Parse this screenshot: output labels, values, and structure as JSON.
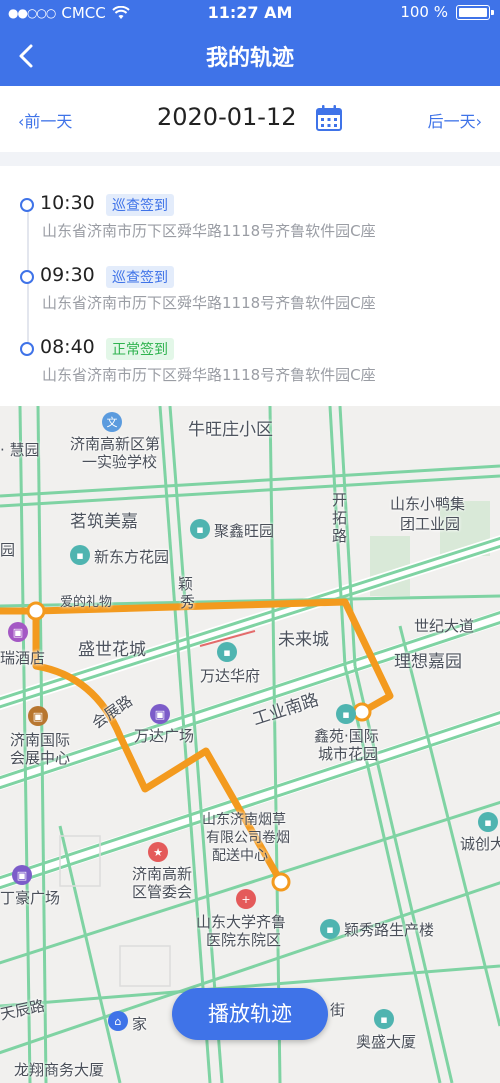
{
  "status_bar": {
    "carrier": "CMCC",
    "time": "11:27 AM",
    "battery": "100 %"
  },
  "nav": {
    "title": "我的轨迹"
  },
  "date_bar": {
    "prev_label": "前一天",
    "date": "2020-01-12",
    "next_label": "后一天"
  },
  "checkins": [
    {
      "time": "10:30",
      "type": "巡查签到",
      "address": "山东省济南市历下区舜华路1118号齐鲁软件园C座"
    },
    {
      "time": "09:30",
      "type": "巡查签到",
      "address": "山东省济南市历下区舜华路1118号齐鲁软件园C座"
    },
    {
      "time": "08:40",
      "type": "正常签到",
      "address": "山东省济南市历下区舜华路1118号齐鲁软件园C座"
    }
  ],
  "map": {
    "labels": {
      "hui_yuan": "· 慧园",
      "school_1": "济南高新区第",
      "school_2": "一实验学校",
      "niuwangzhuang": "牛旺庄小区",
      "kaituolu_1": "开",
      "kaituolu_2": "拓",
      "kaituolu_3": "路",
      "duck_1": "山东小鸭集",
      "duck_2": "团工业园",
      "mingzhu": "茗筑美嘉",
      "juxin": "聚鑫旺园",
      "yuan": "园",
      "xindongfang": "新东方花园",
      "yingxiu_1": "颖",
      "yingxiu_2": "秀",
      "aide": "爱的礼物",
      "shengshi": "盛世花城",
      "weilai": "未来城",
      "shiji": "世纪大道",
      "lixiang": "理想嘉园",
      "ruirui": "瑞酒店",
      "wanda_hf": "万达华府",
      "gongyenan": "工业南路",
      "huizhan_1": "济南国际",
      "huizhan_2": "会展中心",
      "wanda_gc": "万达广场",
      "huizhanlu": "会展路",
      "xinyuan_1": "鑫苑·国际",
      "xinyuan_2": "城市花园",
      "tobacco_1": "山东济南烟草",
      "tobacco_2": "有限公司卷烟",
      "tobacco_3": "配送中心",
      "chengchuang": "诚创大",
      "gaoxin_1": "济南高新",
      "gaoxin_2": "区管委会",
      "dinghao": "丁豪广场",
      "hospital_1": "山东大学齐鲁",
      "hospital_2": "医院东院区",
      "yingxiulu": "颖秀路生产楼",
      "tianchen": "天辰路",
      "jia": "家",
      "jie": "街",
      "aosheng": "奥盛大厦",
      "longxiang": "龙翔商务大厦"
    }
  },
  "play_button": "播放轨迹",
  "colors": {
    "primary": "#3f73e8",
    "track": "#f39a1e",
    "road_green": "#7fd3a3"
  }
}
